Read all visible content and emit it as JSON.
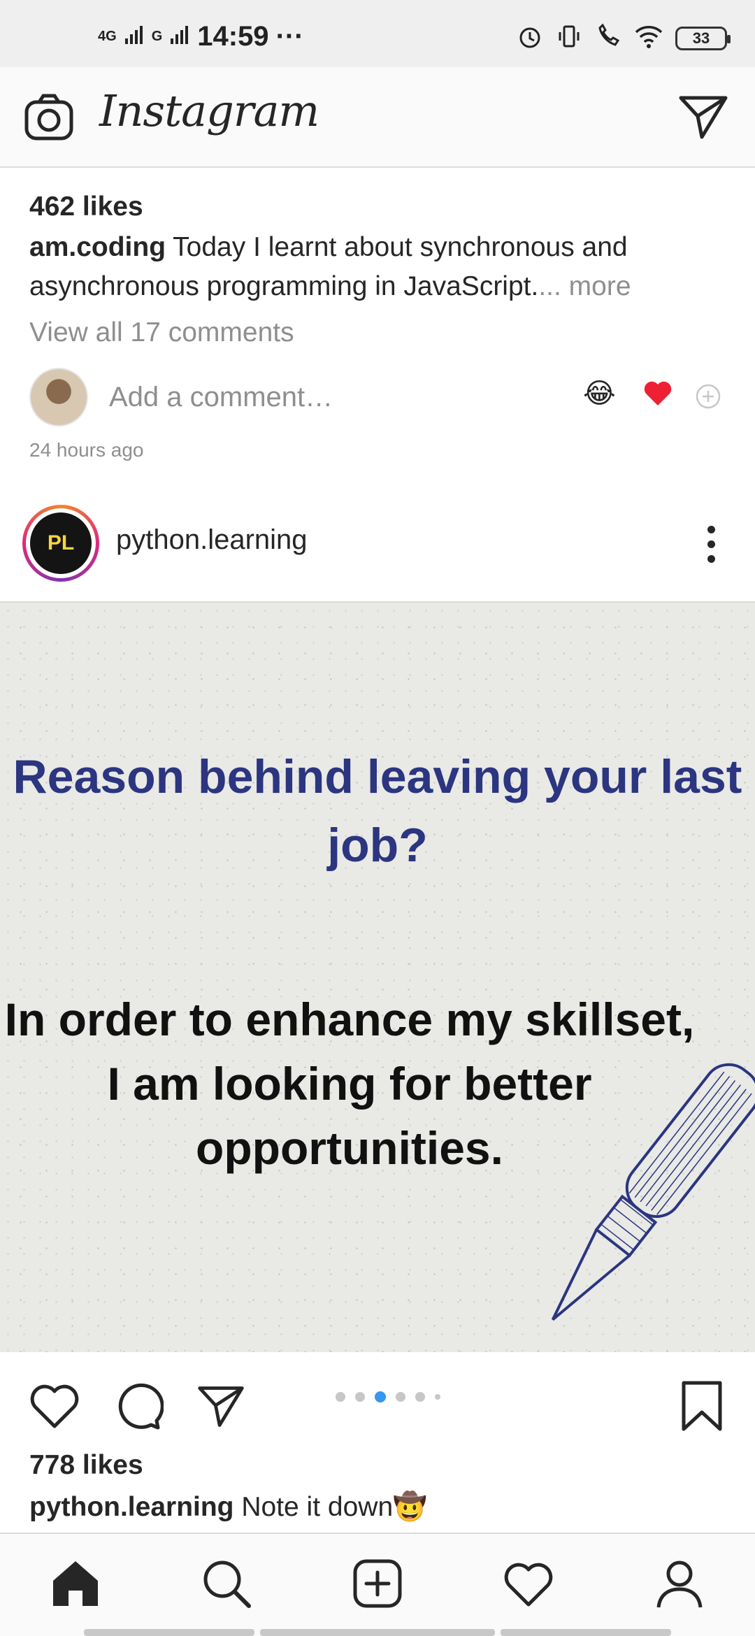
{
  "status_bar": {
    "network_1": "4G",
    "network_2": "G",
    "time": "14:59",
    "more": "···",
    "battery": "33"
  },
  "app": {
    "title": "Instagram"
  },
  "prev_post": {
    "likes": "462 likes",
    "author": "am.coding",
    "caption": "Today I learnt about synchronous and asynchronous programming in JavaScript.",
    "caption_more": "... more",
    "view_comments": "View all 17 comments",
    "add_comment_placeholder": "Add a comment…",
    "quick_reactions": [
      "😂",
      "❤️",
      "⊕"
    ],
    "timestamp": "24 hours ago"
  },
  "post": {
    "username": "python.learning",
    "avatar_text": "PL",
    "image_title": "Reason behind leaving your last job?",
    "image_body": "In order to enhance my skillset, I am looking for better opportunities.",
    "carousel": {
      "count": 6,
      "active_index": 2
    },
    "likes": "778 likes",
    "caption_author": "python.learning",
    "caption": "Note it down",
    "caption_emoji": "🤠"
  },
  "nav": {
    "items": [
      "home-icon",
      "search-icon",
      "add-post-icon",
      "activity-heart-icon",
      "profile-icon"
    ]
  },
  "colors": {
    "active_dot": "#3897f0",
    "reaction_heart": "#ed2133",
    "image_title": "#2b3580"
  }
}
